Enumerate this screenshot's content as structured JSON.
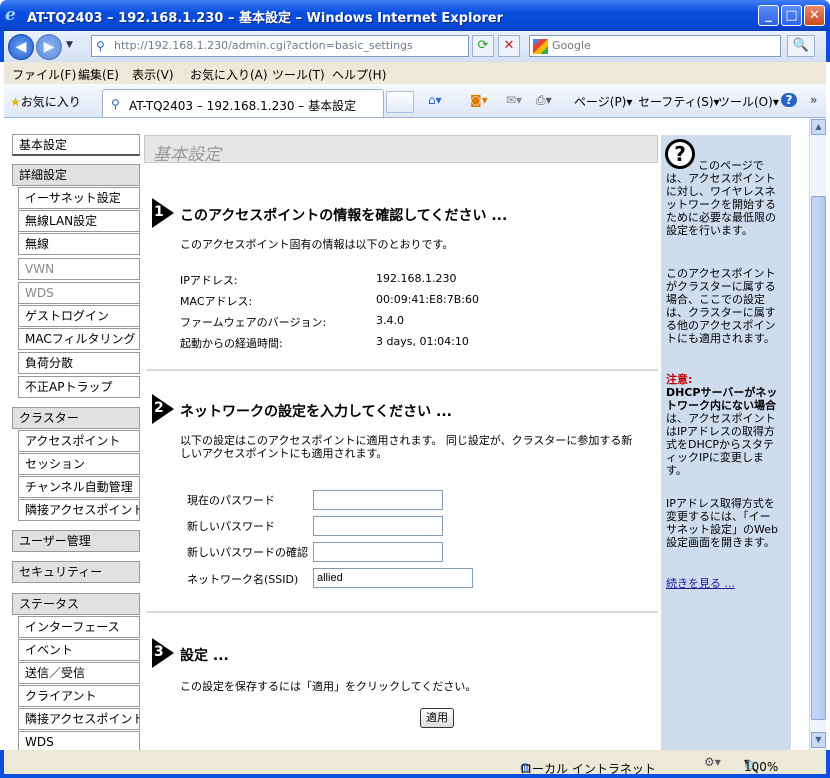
{
  "window": {
    "title": "AT-TQ2403 – 192.168.1.230 – 基本設定 – Windows Internet Explorer",
    "minimize": "_",
    "maximize": "□",
    "close": "✕"
  },
  "addressbar": {
    "url": "http://192.168.1.230/admin.cgi?action=basic_settings",
    "search_placeholder": "Google",
    "back_icon": "◀",
    "forward_icon": "▶",
    "refresh_icon": "⟳",
    "stop_icon": "✕",
    "search_icon": "🔍"
  },
  "menubar": [
    "ファイル(F)",
    "編集(E)",
    "表示(V)",
    "お気に入り(A)",
    "ツール(T)",
    "ヘルプ(H)"
  ],
  "favbar": {
    "favorites": "お気に入り",
    "tab_title": "AT-TQ2403 – 192.168.1.230 – 基本設定",
    "page": "ページ(P)",
    "safety": "セーフティ(S)",
    "tools": "ツール(O)",
    "help": "?"
  },
  "sidebar": {
    "basic": "基本設定",
    "advanced": "詳細設定",
    "advanced_items": [
      "イーサネット設定",
      "無線LAN設定",
      "無線",
      "VWN",
      "WDS",
      "ゲストログイン",
      "MACフィルタリング",
      "負荷分散",
      "不正APトラップ"
    ],
    "cluster": "クラスター",
    "cluster_items": [
      "アクセスポイント",
      "セッション",
      "チャンネル自動管理",
      "隣接アクセスポイント"
    ],
    "user_mgmt": "ユーザー管理",
    "security": "セキュリティー",
    "status": "ステータス",
    "status_items": [
      "インターフェース",
      "イベント",
      "送信／受信",
      "クライアント",
      "隣接アクセスポイント",
      "WDS"
    ]
  },
  "main": {
    "page_title": "基本設定",
    "section1": {
      "num": "1",
      "heading": "このアクセスポイントの情報を確認してください ...",
      "desc": "このアクセスポイント固有の情報は以下のとおりです。",
      "rows": [
        {
          "label": "IPアドレス:",
          "value": "192.168.1.230"
        },
        {
          "label": "MACアドレス:",
          "value": "00:09:41:E8:7B:60"
        },
        {
          "label": "ファームウェアのバージョン:",
          "value": "3.4.0"
        },
        {
          "label": "起動からの経過時間:",
          "value": "3 days, 01:04:10"
        }
      ]
    },
    "section2": {
      "num": "2",
      "heading": "ネットワークの設定を入力してください ...",
      "desc1": "以下の設定はこのアクセスポイントに適用されます。 同じ設定が、クラスターに参加する新",
      "desc2": "しいアクセスポイントにも適用されます。",
      "fields": [
        {
          "label": "現在のパスワード",
          "value": ""
        },
        {
          "label": "新しいパスワード",
          "value": ""
        },
        {
          "label": "新しいパスワードの確認",
          "value": ""
        },
        {
          "label": "ネットワーク名(SSID)",
          "value": "allied"
        }
      ]
    },
    "section3": {
      "num": "3",
      "heading": "設定 ...",
      "desc": "この設定を保存するには「適用」をクリックしてください。",
      "apply": "適用"
    }
  },
  "help": {
    "icon": "?",
    "p1": "このページでは、アクセスポイントに対し、ワイヤレスネットワークを開始するために必要な最低限の設定を行います。",
    "p2": "このアクセスポイントがクラスターに属する場合、ここでの設定は、クラスターに属する他のアクセスポイントにも適用されます。",
    "warn_label": "注意:",
    "warn_bold": "DHCPサーバーがネットワーク内にない場合",
    "warn_rest": "は、アクセスポイントはIPアドレスの取得方式をDHCPからスタティックIPに変更します。",
    "p3": "IPアドレス取得方式を変更するには、「イーサネット設定」のWeb設定画面を開きます。",
    "more": "続きを見る ..."
  },
  "statusbar": {
    "zone": "ローカル イントラネット",
    "zoom": "100%"
  }
}
